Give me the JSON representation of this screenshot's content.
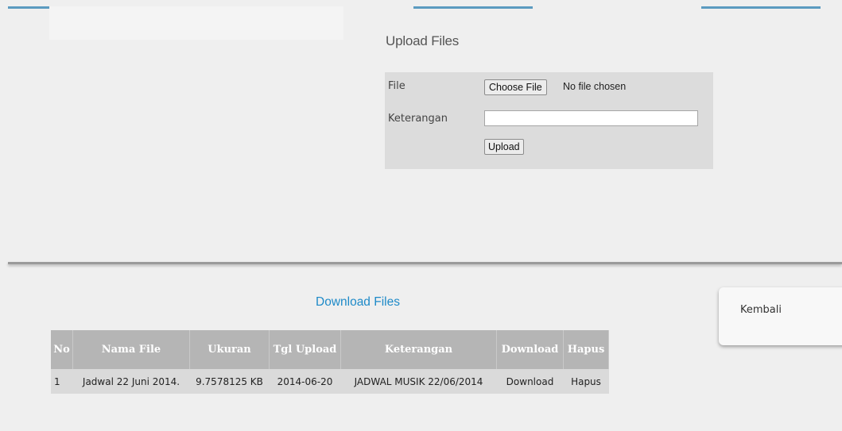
{
  "upload": {
    "title": "Upload Files",
    "file_label": "File",
    "choose_file_label": "Choose File",
    "no_file_text": "No file chosen",
    "keterangan_label": "Keterangan",
    "keterangan_value": "",
    "upload_button": "Upload"
  },
  "download": {
    "title": "Download Files",
    "columns": [
      "No",
      "Nama File",
      "Ukuran",
      "Tgl Upload",
      "Keterangan",
      "Download",
      "Hapus"
    ],
    "rows": [
      {
        "no": "1",
        "nama_file": "Jadwal 22 Juni 2014.",
        "ukuran": "9.7578125 KB",
        "tgl_upload": "2014-06-20",
        "keterangan": "JADWAL MUSIK 22/06/2014",
        "download": "Download",
        "hapus": "Hapus"
      }
    ]
  },
  "nav": {
    "kembali": "Kembali"
  },
  "colors": {
    "link_blue": "#1e8ac8",
    "header_gray": "#b5b5b5",
    "row_gray": "#dadada",
    "form_gray": "#dcdcdc"
  }
}
